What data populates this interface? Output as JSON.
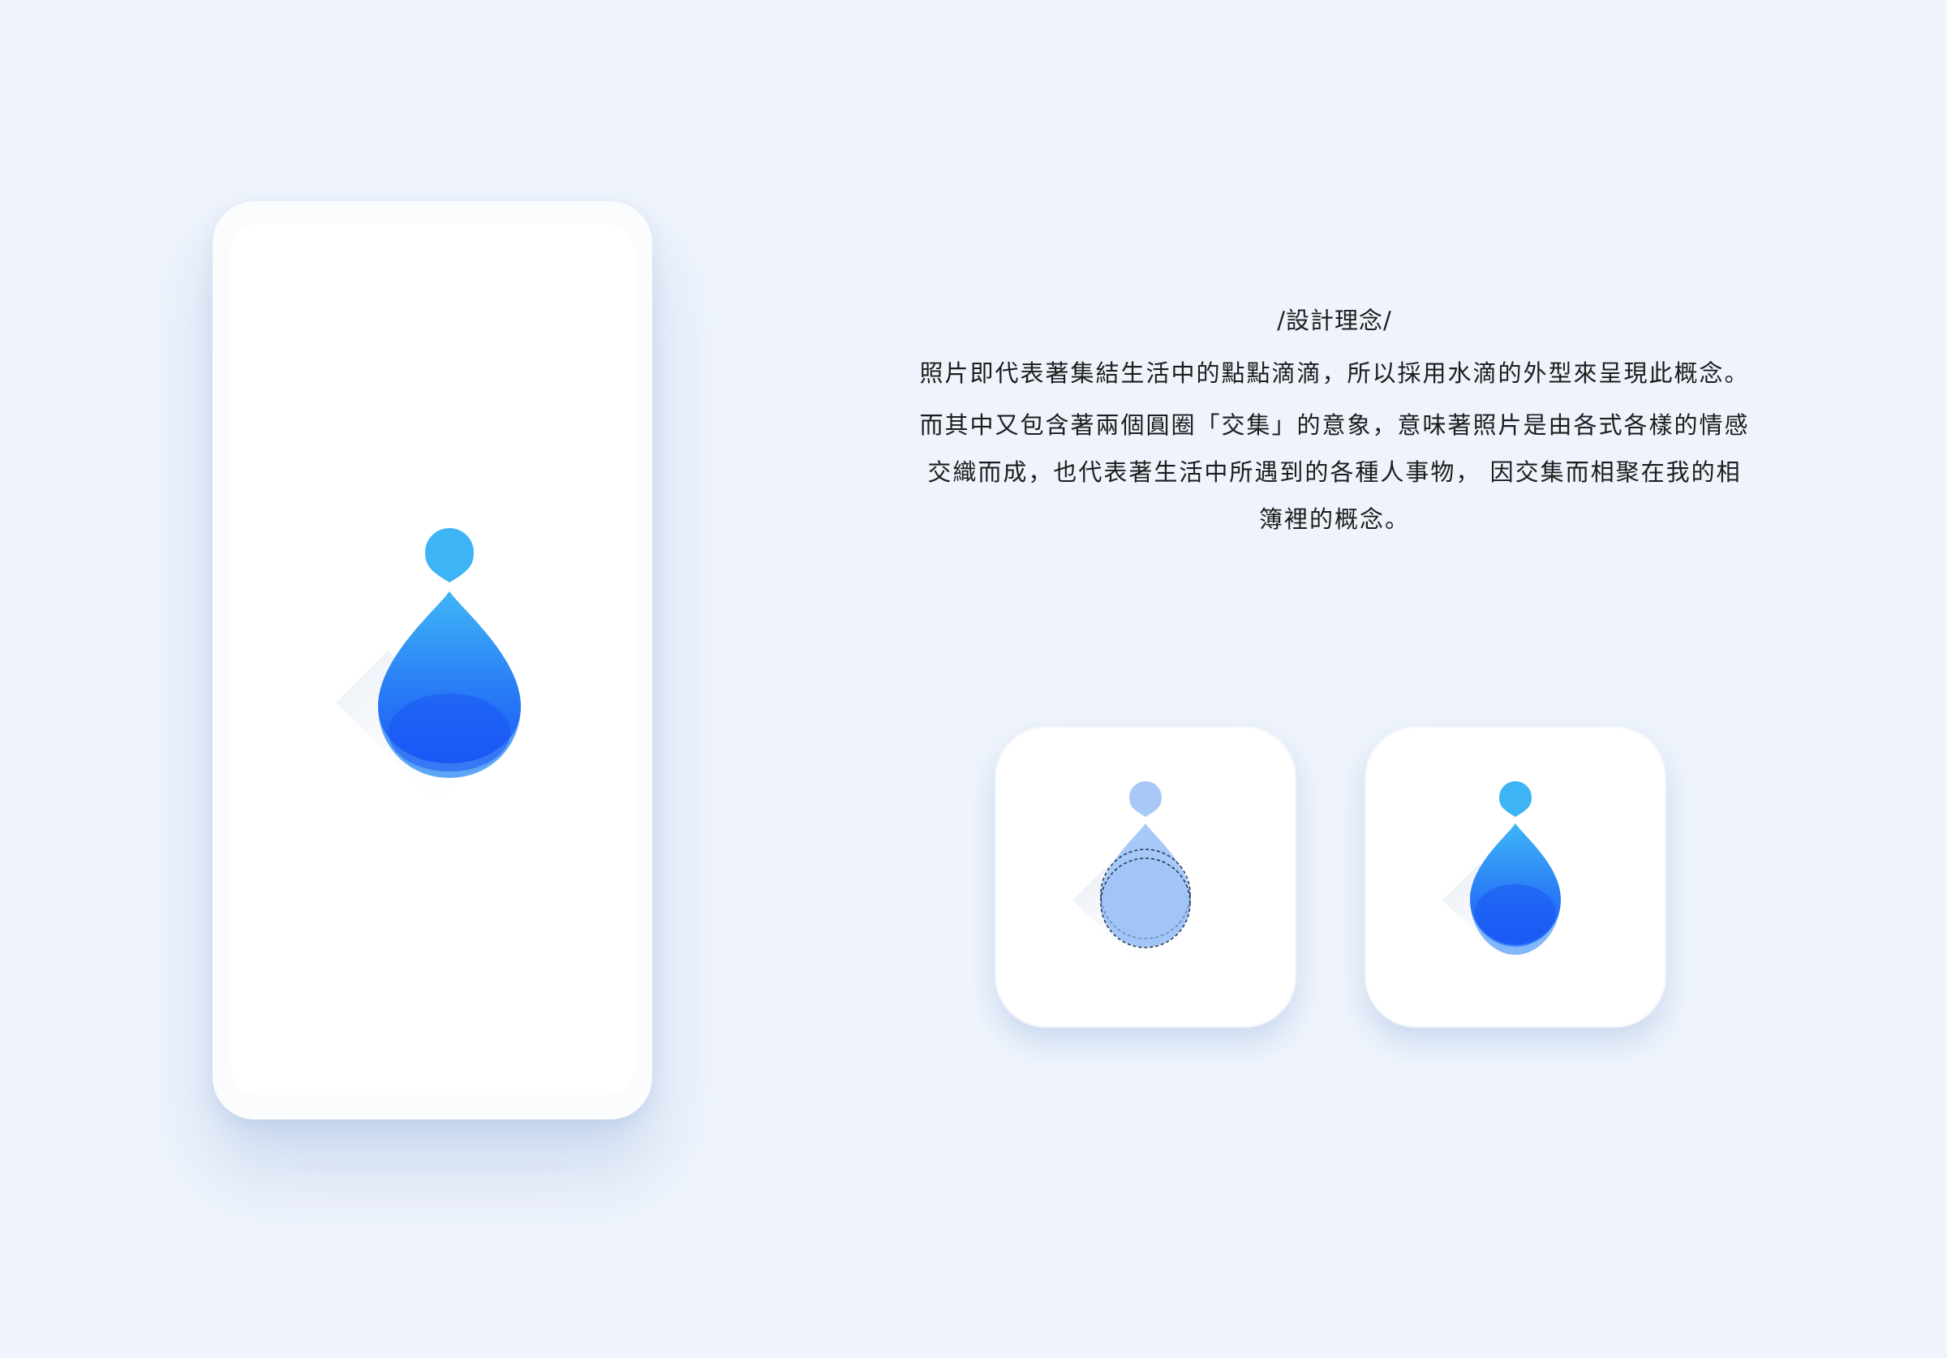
{
  "design_concept": {
    "heading": "/設計理念/",
    "line1": "照片即代表著集結生活中的點點滴滴，所以採用水滴的外型來呈現此概念。",
    "paragraph_lines": [
      "而其中又包含著兩個圓圈「交集」的意象，意味著照片是由各式各樣的情感",
      "交織而成，也代表著生活中所遇到的各種人事物， 因交集而相聚在我的相",
      "簿裡的概念。"
    ]
  },
  "colors": {
    "background": "#eff4fc",
    "drop_top": "#40b8f6",
    "drop_bottom": "#1a5cf5",
    "drop_light": "#a9ccf8"
  },
  "icons": [
    "water-drop-logo",
    "water-drop-construction-icon",
    "water-drop-app-icon"
  ]
}
